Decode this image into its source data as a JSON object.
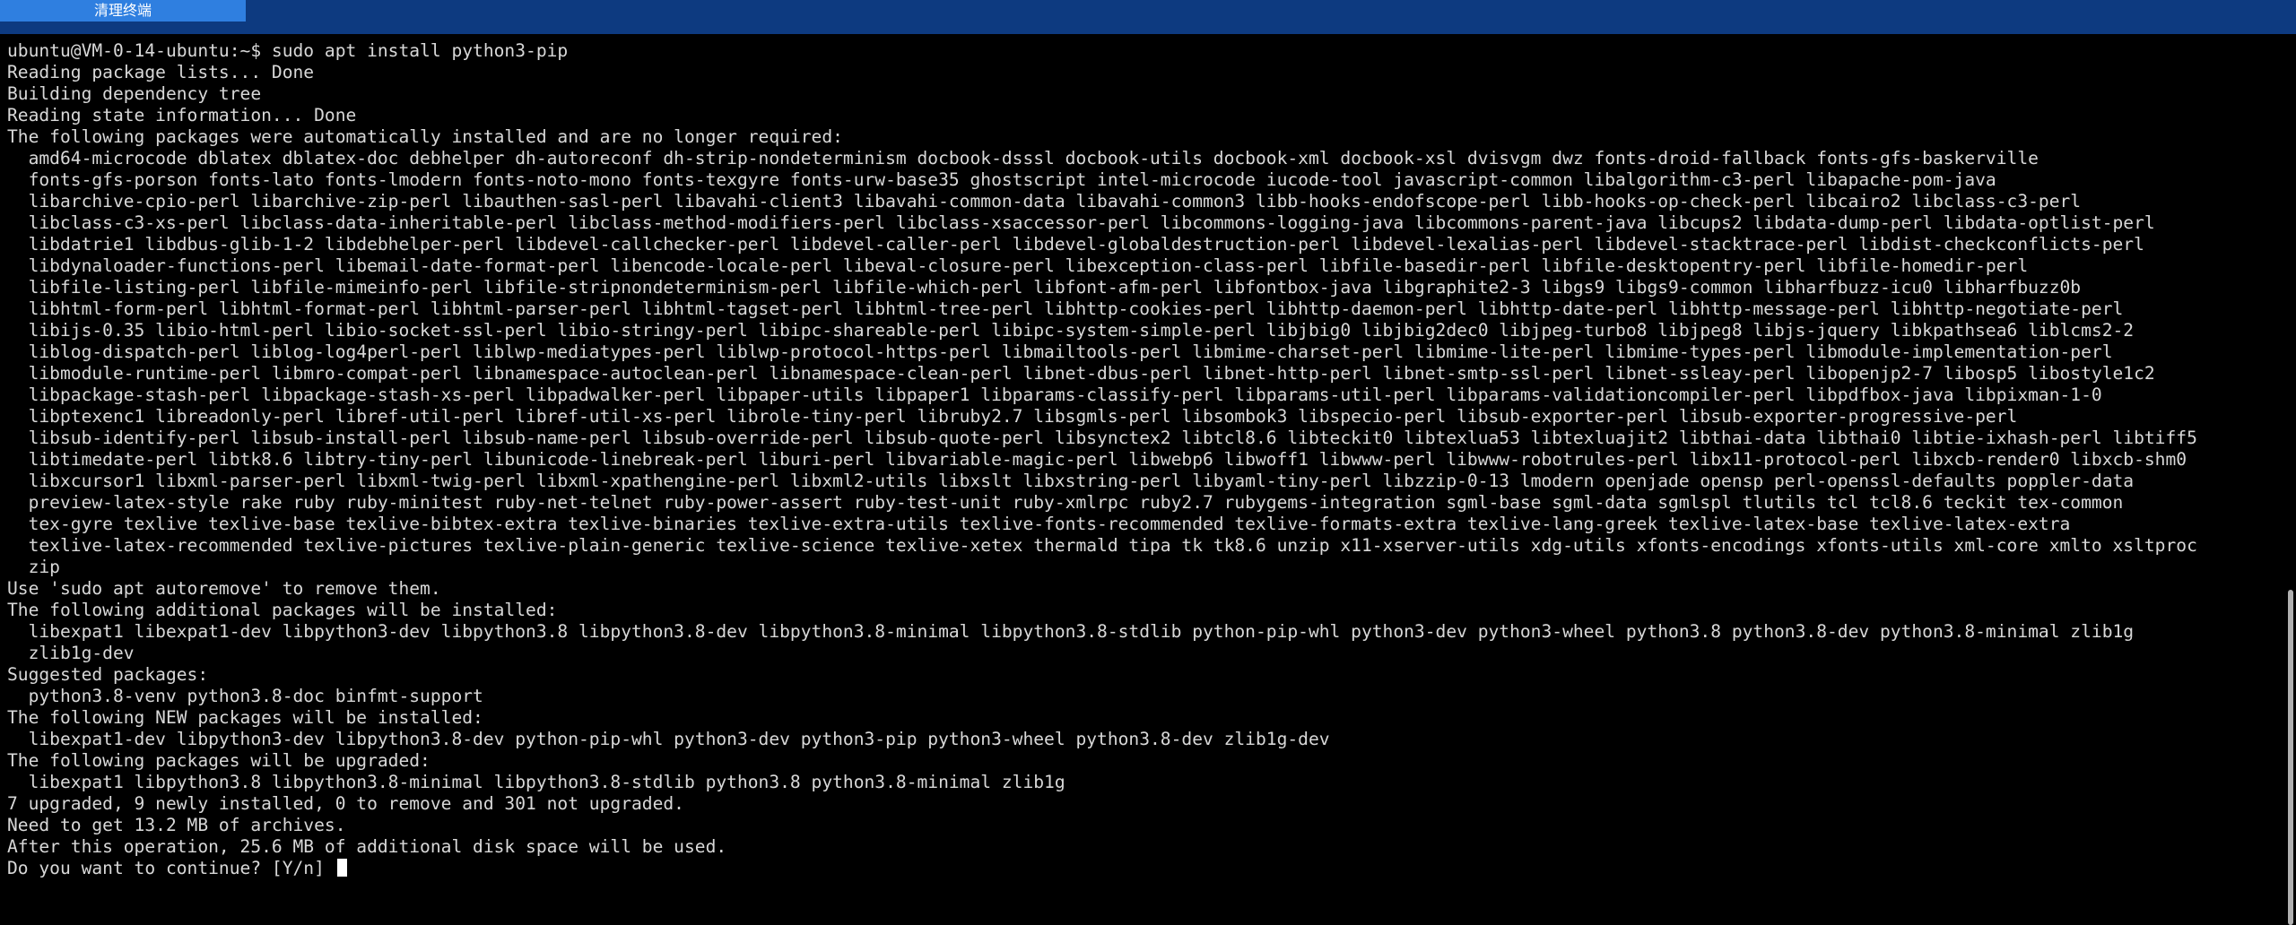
{
  "toolbar": {
    "clear_terminal_label": "清理终端"
  },
  "colors": {
    "topbar": "#0d3a80",
    "tab": "#2f7fe0",
    "terminal_bg": "#000000",
    "terminal_fg": "#d8d8d8"
  },
  "terminal": {
    "lines": [
      "ubuntu@VM-0-14-ubuntu:~$ sudo apt install python3-pip",
      "Reading package lists... Done",
      "Building dependency tree",
      "Reading state information... Done",
      "The following packages were automatically installed and are no longer required:",
      "  amd64-microcode dblatex dblatex-doc debhelper dh-autoreconf dh-strip-nondeterminism docbook-dsssl docbook-utils docbook-xml docbook-xsl dvisvgm dwz fonts-droid-fallback fonts-gfs-baskerville",
      "  fonts-gfs-porson fonts-lato fonts-lmodern fonts-noto-mono fonts-texgyre fonts-urw-base35 ghostscript intel-microcode iucode-tool javascript-common libalgorithm-c3-perl libapache-pom-java",
      "  libarchive-cpio-perl libarchive-zip-perl libauthen-sasl-perl libavahi-client3 libavahi-common-data libavahi-common3 libb-hooks-endofscope-perl libb-hooks-op-check-perl libcairo2 libclass-c3-perl",
      "  libclass-c3-xs-perl libclass-data-inheritable-perl libclass-method-modifiers-perl libclass-xsaccessor-perl libcommons-logging-java libcommons-parent-java libcups2 libdata-dump-perl libdata-optlist-perl",
      "  libdatrie1 libdbus-glib-1-2 libdebhelper-perl libdevel-callchecker-perl libdevel-caller-perl libdevel-globaldestruction-perl libdevel-lexalias-perl libdevel-stacktrace-perl libdist-checkconflicts-perl",
      "  libdynaloader-functions-perl libemail-date-format-perl libencode-locale-perl libeval-closure-perl libexception-class-perl libfile-basedir-perl libfile-desktopentry-perl libfile-homedir-perl",
      "  libfile-listing-perl libfile-mimeinfo-perl libfile-stripnondeterminism-perl libfile-which-perl libfont-afm-perl libfontbox-java libgraphite2-3 libgs9 libgs9-common libharfbuzz-icu0 libharfbuzz0b",
      "  libhtml-form-perl libhtml-format-perl libhtml-parser-perl libhtml-tagset-perl libhtml-tree-perl libhttp-cookies-perl libhttp-daemon-perl libhttp-date-perl libhttp-message-perl libhttp-negotiate-perl",
      "  libijs-0.35 libio-html-perl libio-socket-ssl-perl libio-stringy-perl libipc-shareable-perl libipc-system-simple-perl libjbig0 libjbig2dec0 libjpeg-turbo8 libjpeg8 libjs-jquery libkpathsea6 liblcms2-2",
      "  liblog-dispatch-perl liblog-log4perl-perl liblwp-mediatypes-perl liblwp-protocol-https-perl libmailtools-perl libmime-charset-perl libmime-lite-perl libmime-types-perl libmodule-implementation-perl",
      "  libmodule-runtime-perl libmro-compat-perl libnamespace-autoclean-perl libnamespace-clean-perl libnet-dbus-perl libnet-http-perl libnet-smtp-ssl-perl libnet-ssleay-perl libopenjp2-7 libosp5 libostyle1c2",
      "  libpackage-stash-perl libpackage-stash-xs-perl libpadwalker-perl libpaper-utils libpaper1 libparams-classify-perl libparams-util-perl libparams-validationcompiler-perl libpdfbox-java libpixman-1-0",
      "  libptexenc1 libreadonly-perl libref-util-perl libref-util-xs-perl librole-tiny-perl libruby2.7 libsgmls-perl libsombok3 libspecio-perl libsub-exporter-perl libsub-exporter-progressive-perl",
      "  libsub-identify-perl libsub-install-perl libsub-name-perl libsub-override-perl libsub-quote-perl libsynctex2 libtcl8.6 libteckit0 libtexlua53 libtexluajit2 libthai-data libthai0 libtie-ixhash-perl libtiff5",
      "  libtimedate-perl libtk8.6 libtry-tiny-perl libunicode-linebreak-perl liburi-perl libvariable-magic-perl libwebp6 libwoff1 libwww-perl libwww-robotrules-perl libx11-protocol-perl libxcb-render0 libxcb-shm0",
      "  libxcursor1 libxml-parser-perl libxml-twig-perl libxml-xpathengine-perl libxml2-utils libxslt libxstring-perl libyaml-tiny-perl libzzip-0-13 lmodern openjade opensp perl-openssl-defaults poppler-data",
      "  preview-latex-style rake ruby ruby-minitest ruby-net-telnet ruby-power-assert ruby-test-unit ruby-xmlrpc ruby2.7 rubygems-integration sgml-base sgml-data sgmlspl tlutils tcl tcl8.6 teckit tex-common",
      "  tex-gyre texlive texlive-base texlive-bibtex-extra texlive-binaries texlive-extra-utils texlive-fonts-recommended texlive-formats-extra texlive-lang-greek texlive-latex-base texlive-latex-extra",
      "  texlive-latex-recommended texlive-pictures texlive-plain-generic texlive-science texlive-xetex thermald tipa tk tk8.6 unzip x11-xserver-utils xdg-utils xfonts-encodings xfonts-utils xml-core xmlto xsltproc",
      "  zip",
      "Use 'sudo apt autoremove' to remove them.",
      "The following additional packages will be installed:",
      "  libexpat1 libexpat1-dev libpython3-dev libpython3.8 libpython3.8-dev libpython3.8-minimal libpython3.8-stdlib python-pip-whl python3-dev python3-wheel python3.8 python3.8-dev python3.8-minimal zlib1g",
      "  zlib1g-dev",
      "Suggested packages:",
      "  python3.8-venv python3.8-doc binfmt-support",
      "The following NEW packages will be installed:",
      "  libexpat1-dev libpython3-dev libpython3.8-dev python-pip-whl python3-dev python3-pip python3-wheel python3.8-dev zlib1g-dev",
      "The following packages will be upgraded:",
      "  libexpat1 libpython3.8 libpython3.8-minimal libpython3.8-stdlib python3.8 python3.8-minimal zlib1g",
      "7 upgraded, 9 newly installed, 0 to remove and 301 not upgraded.",
      "Need to get 13.2 MB of archives.",
      "After this operation, 25.6 MB of additional disk space will be used."
    ],
    "prompt_line": "Do you want to continue? [Y/n] "
  }
}
